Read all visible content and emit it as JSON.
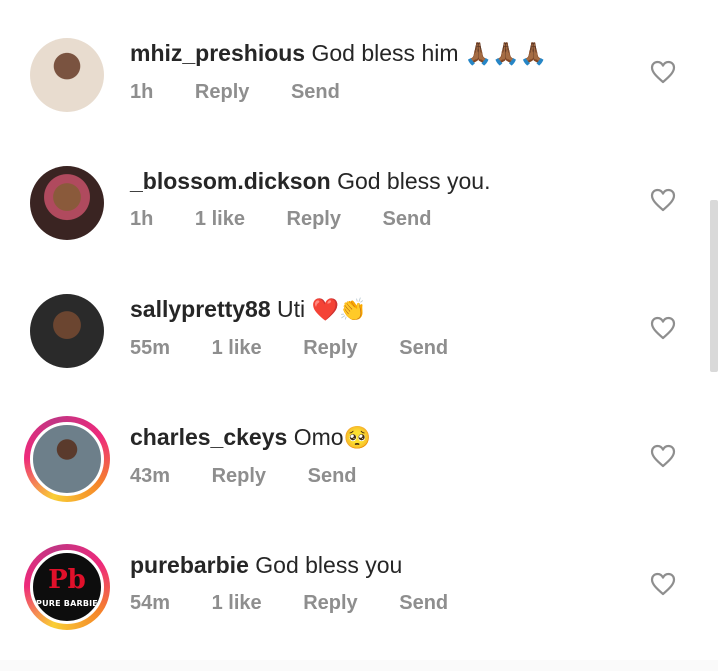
{
  "comments": [
    {
      "username": "mhiz_preshious",
      "text": "God bless him",
      "emoji": "🙏🏾🙏🏾🙏🏾",
      "time": "1h",
      "likes": "",
      "reply": "Reply",
      "send": "Send",
      "has_story": false
    },
    {
      "username": "_blossom.dickson",
      "text": "God bless you.",
      "emoji": "",
      "time": "1h",
      "likes": "1 like",
      "reply": "Reply",
      "send": "Send",
      "has_story": false
    },
    {
      "username": "sallypretty88",
      "text": "Uti",
      "emoji": "❤️👏",
      "time": "55m",
      "likes": "1 like",
      "reply": "Reply",
      "send": "Send",
      "has_story": false
    },
    {
      "username": "charles_ckeys",
      "text": "Omo",
      "emoji": "🥺",
      "time": "43m",
      "likes": "",
      "reply": "Reply",
      "send": "Send",
      "has_story": true
    },
    {
      "username": "purebarbie",
      "text": "God bless you",
      "emoji": "",
      "time": "54m",
      "likes": "1 like",
      "reply": "Reply",
      "send": "Send",
      "has_story": true,
      "avatar_logo": {
        "mark": "Pb",
        "brand": "PURE BARBIE"
      }
    }
  ],
  "colors": {
    "username": "#262626",
    "meta": "#8e8e8e",
    "heart_outline": "#8e8e8e",
    "story_ring": "#ee2a7b"
  },
  "icons": {
    "like": "heart-outline-icon"
  }
}
